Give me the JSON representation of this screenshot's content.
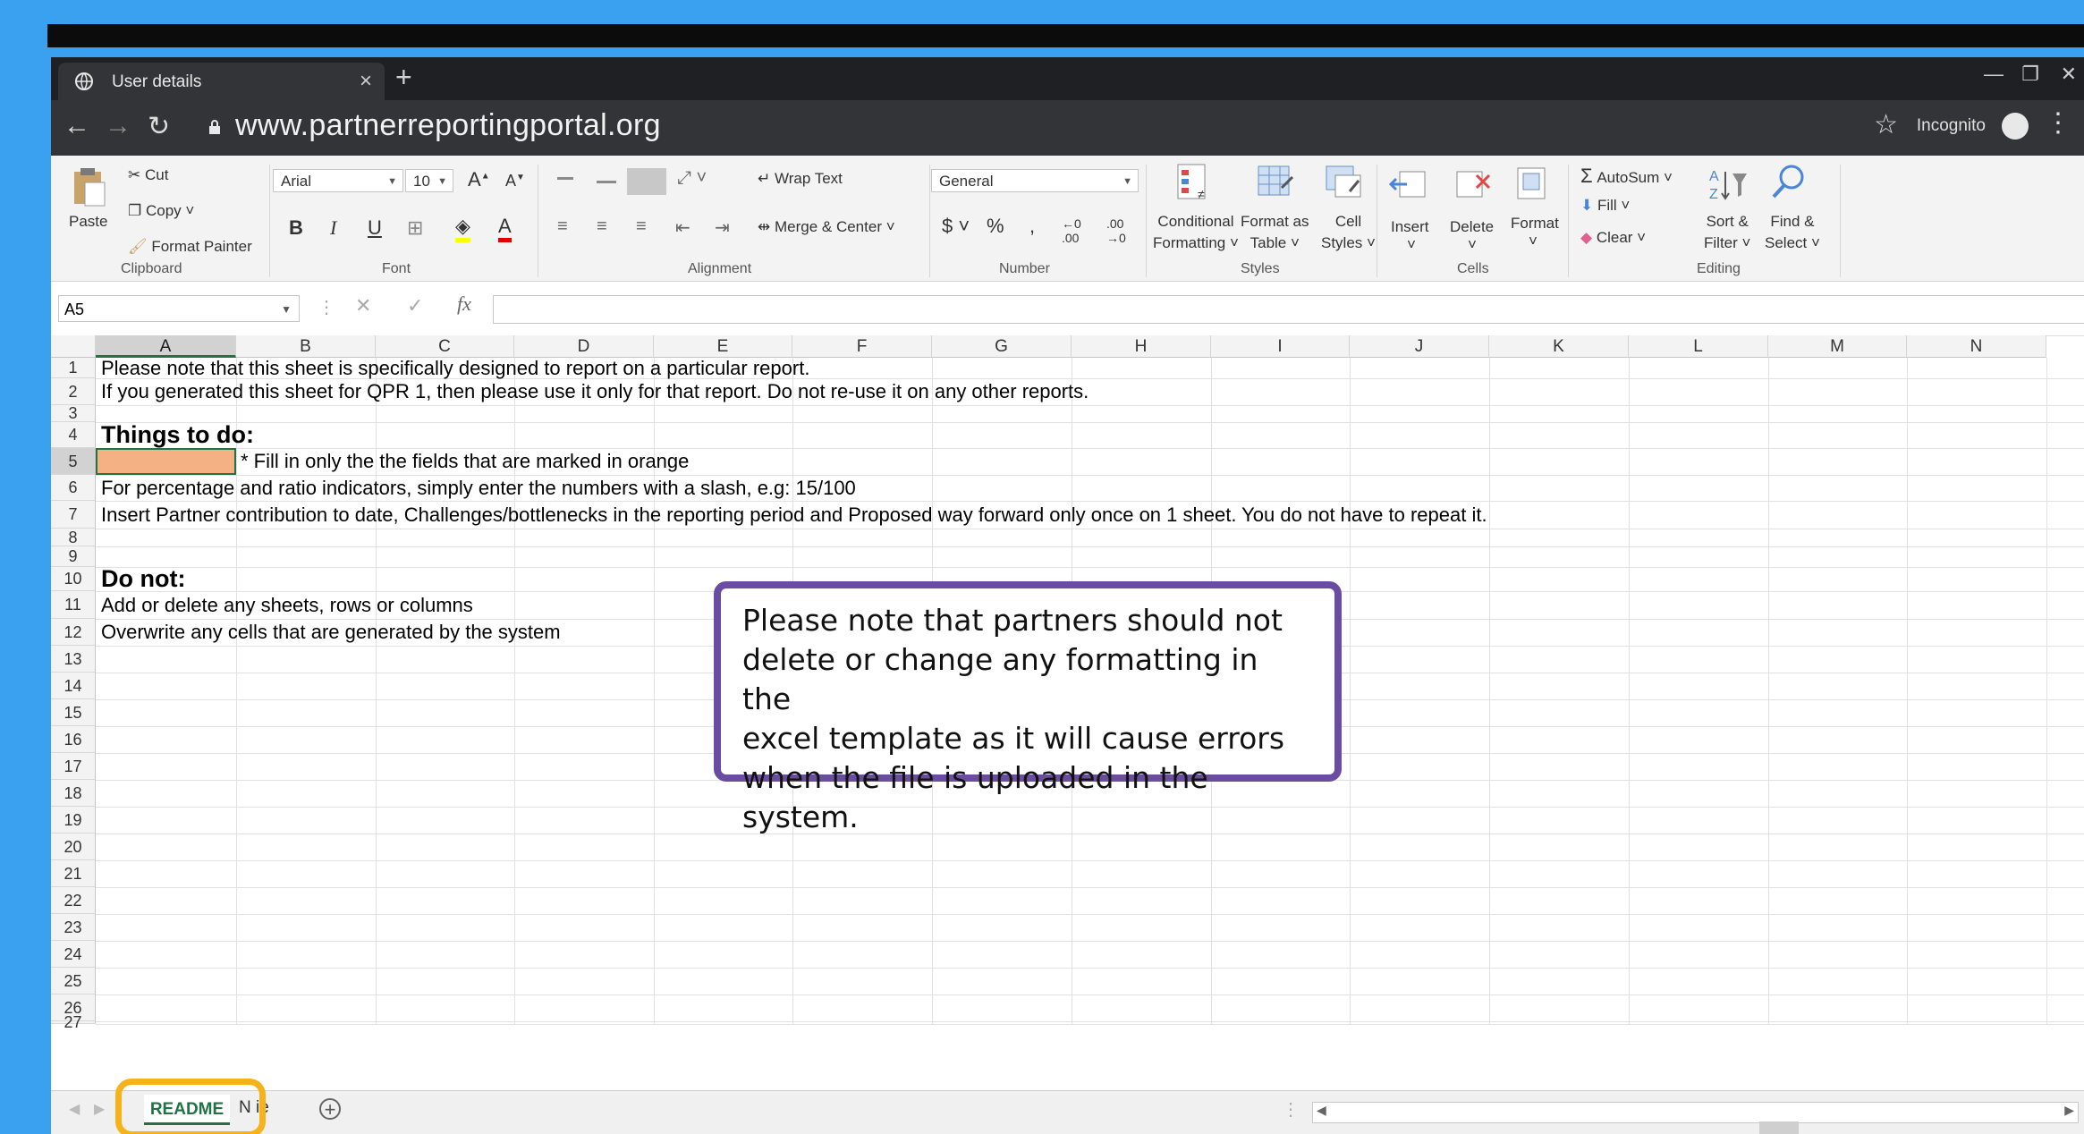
{
  "browser": {
    "tab_title": "User details",
    "url": "www.partnerreportingportal.org",
    "incognito_label": "Incognito"
  },
  "ribbon": {
    "clipboard": {
      "paste": "Paste",
      "cut": "Cut",
      "copy": "Copy",
      "format_painter": "Format Painter",
      "group": "Clipboard"
    },
    "font": {
      "name": "Arial",
      "size": "10",
      "group": "Font"
    },
    "alignment": {
      "wrap_text": "Wrap Text",
      "merge_center": "Merge & Center",
      "group": "Alignment"
    },
    "number": {
      "format": "General",
      "group": "Number"
    },
    "styles": {
      "conditional_1": "Conditional",
      "conditional_2": "Formatting",
      "format_as_1": "Format as",
      "format_as_2": "Table",
      "cell_1": "Cell",
      "cell_2": "Styles",
      "group": "Styles"
    },
    "cells": {
      "insert": "Insert",
      "delete": "Delete",
      "format": "Format",
      "group": "Cells"
    },
    "editing": {
      "autosum": "AutoSum",
      "fill": "Fill",
      "clear": "Clear",
      "sort_1": "Sort &",
      "sort_2": "Filter",
      "find_1": "Find &",
      "find_2": "Select",
      "group": "Editing"
    }
  },
  "formula_bar": {
    "name_box": "A5",
    "fx": "fx",
    "value": ""
  },
  "columns": [
    "A",
    "B",
    "C",
    "D",
    "E",
    "F",
    "G",
    "H",
    "I",
    "J",
    "K",
    "L",
    "M",
    "N"
  ],
  "rows": [
    "1",
    "2",
    "3",
    "4",
    "5",
    "6",
    "7",
    "8",
    "9",
    "10",
    "11",
    "12",
    "13",
    "14",
    "15",
    "16",
    "17",
    "18",
    "19",
    "20",
    "21",
    "22",
    "23",
    "24",
    "25",
    "26",
    "27"
  ],
  "cells": {
    "r1": "Please note that this sheet is specifically designed to report on a particular report.",
    "r2": "If you generated this sheet for QPR 1, then please use it only for that report. Do not re-use it on any other reports.",
    "r4": "Things to do:",
    "r5": "* Fill in only the the fields that are marked in orange",
    "r6": "For percentage and ratio indicators, simply enter the numbers with a slash, e.g: 15/100",
    "r7": "Insert Partner contribution to date, Challenges/bottlenecks in the reporting period and Proposed way forward only once on 1 sheet. You do not have to repeat it.",
    "r10": "Do not:",
    "r11": "Add or delete any sheets, rows or columns",
    "r12": "Overwrite any cells that are generated by the system"
  },
  "callout": {
    "line1": "Please note that partners should not",
    "line2": "delete or change any formatting in the",
    "line3": "excel template as it will cause errors",
    "line4": "when the file is uploaded in the system."
  },
  "sheets": {
    "active": "README",
    "next": "N  ie"
  },
  "colors": {
    "excel_green": "#217346",
    "orange_fill": "#f4b183",
    "callout_border": "#6a4da0",
    "highlight": "#f6b21a"
  }
}
